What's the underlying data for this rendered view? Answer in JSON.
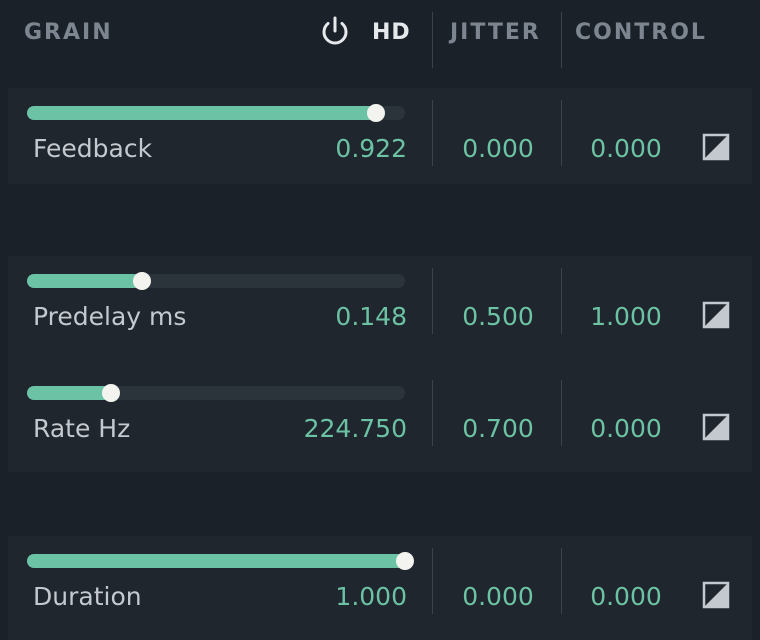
{
  "header": {
    "grain_label": "GRAIN",
    "hd_label": "HD",
    "jitter_label": "JITTER",
    "control_label": "CONTROL",
    "power_icon": "power-icon"
  },
  "colors": {
    "background": "#1b2128",
    "block": "#1f262d",
    "accent": "#6cc2a4",
    "label": "#c4c9cf",
    "header": "#7d8690"
  },
  "params": [
    {
      "label": "Feedback",
      "value": "0.922",
      "jitter": "0.000",
      "control": "0.000",
      "level": 0.922
    },
    {
      "label": "Predelay ms",
      "value": "0.148",
      "jitter": "0.500",
      "control": "1.000",
      "level": 0.305
    },
    {
      "label": "Rate Hz",
      "value": "224.750",
      "jitter": "0.700",
      "control": "0.000",
      "level": 0.222
    },
    {
      "label": "Duration",
      "value": "1.000",
      "jitter": "0.000",
      "control": "0.000",
      "level": 1.0
    }
  ]
}
